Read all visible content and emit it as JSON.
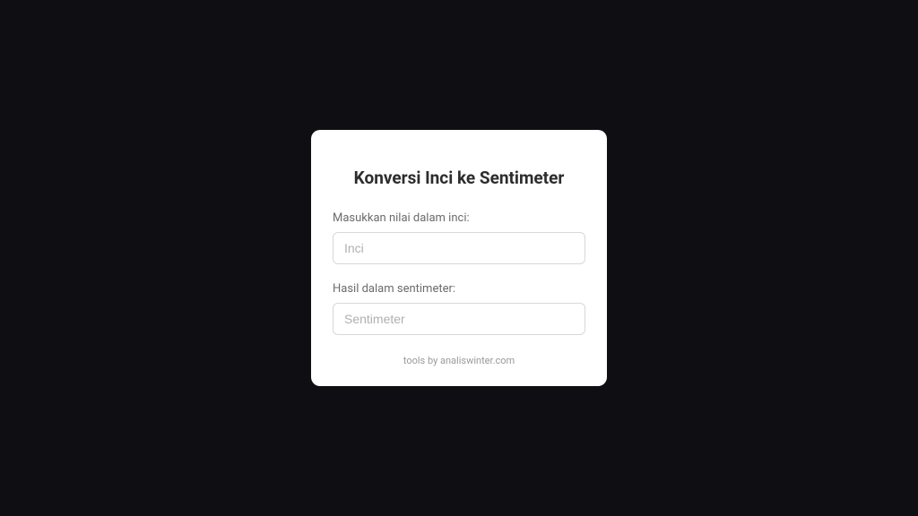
{
  "card": {
    "title": "Konversi Inci ke Sentimeter",
    "input1": {
      "label": "Masukkan nilai dalam inci:",
      "placeholder": "Inci",
      "value": ""
    },
    "input2": {
      "label": "Hasil dalam sentimeter:",
      "placeholder": "Sentimeter",
      "value": ""
    },
    "footer": "tools by analiswinter.com"
  }
}
